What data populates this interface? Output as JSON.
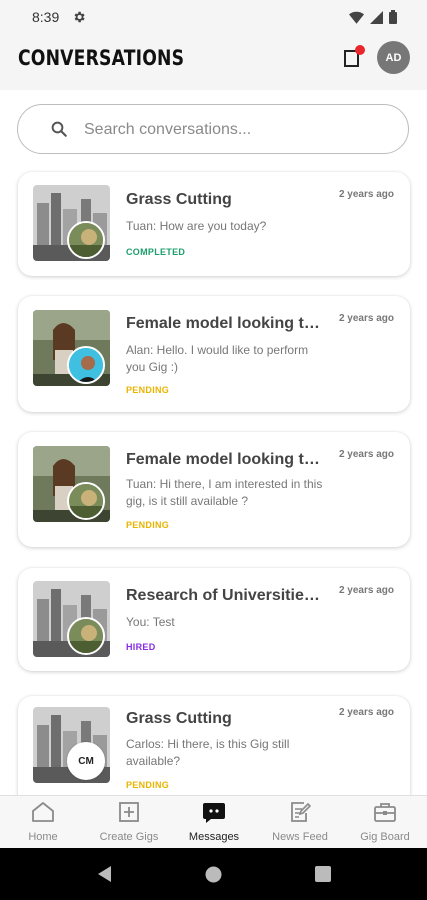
{
  "status_bar": {
    "time": "8:39"
  },
  "header": {
    "title": "CONVERSATIONS",
    "avatar_initials": "AD"
  },
  "search": {
    "placeholder": "Search conversations..."
  },
  "conversations": [
    {
      "title": "Grass Cutting",
      "time": "2 years ago",
      "message": "Tuan: How are you today?",
      "status": "COMPLETED",
      "status_color": "#1e9e6b"
    },
    {
      "title": "Female model looking to...",
      "time": "2 years ago",
      "message": "Alan: Hello. I would like to perform you Gig :)",
      "status": "PENDING",
      "status_color": "#e8b400"
    },
    {
      "title": "Female model looking to...",
      "time": "2 years ago",
      "message": "Tuan: Hi there, I am interested in this gig, is it still available ?",
      "status": "PENDING",
      "status_color": "#e8b400"
    },
    {
      "title": "Research of Universities...",
      "time": "2 years ago",
      "message": "You: Test",
      "status": "HIRED",
      "status_color": "#8a2be2"
    },
    {
      "title": "Grass Cutting",
      "time": "2 years ago",
      "message": "Carlos: Hi there, is this Gig still available?",
      "status": "PENDING",
      "status_color": "#e8b400",
      "badge_initials": "CM"
    }
  ],
  "bottom_nav": [
    {
      "label": "Home",
      "icon": "home-icon"
    },
    {
      "label": "Create Gigs",
      "icon": "plus-square-icon"
    },
    {
      "label": "Messages",
      "icon": "chat-icon",
      "active": true
    },
    {
      "label": "News Feed",
      "icon": "edit-note-icon"
    },
    {
      "label": "Gig Board",
      "icon": "briefcase-icon"
    }
  ]
}
